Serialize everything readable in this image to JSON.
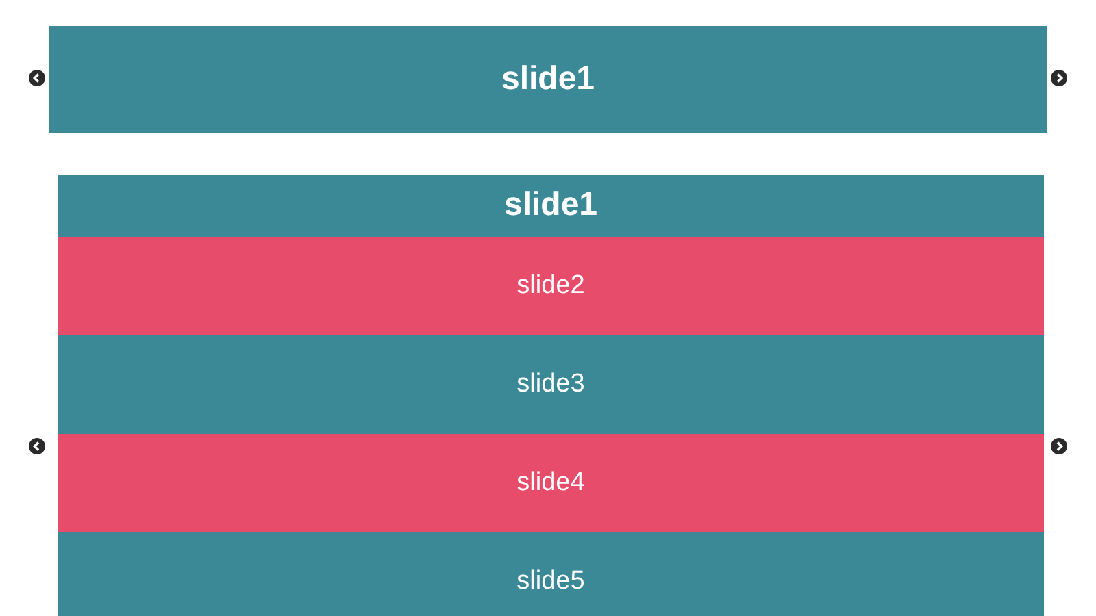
{
  "carousels": [
    {
      "slides": [
        {
          "label": "slide1",
          "selected": true,
          "color": "#3b8896"
        }
      ]
    },
    {
      "slides": [
        {
          "label": "slide1",
          "selected": true,
          "color": "#3b8896"
        },
        {
          "label": "slide2",
          "selected": false,
          "color": "#e84c6b"
        },
        {
          "label": "slide3",
          "selected": false,
          "color": "#3b8896"
        },
        {
          "label": "slide4",
          "selected": false,
          "color": "#e84c6b"
        },
        {
          "label": "slide5",
          "selected": false,
          "color": "#3b8896"
        }
      ]
    }
  ]
}
